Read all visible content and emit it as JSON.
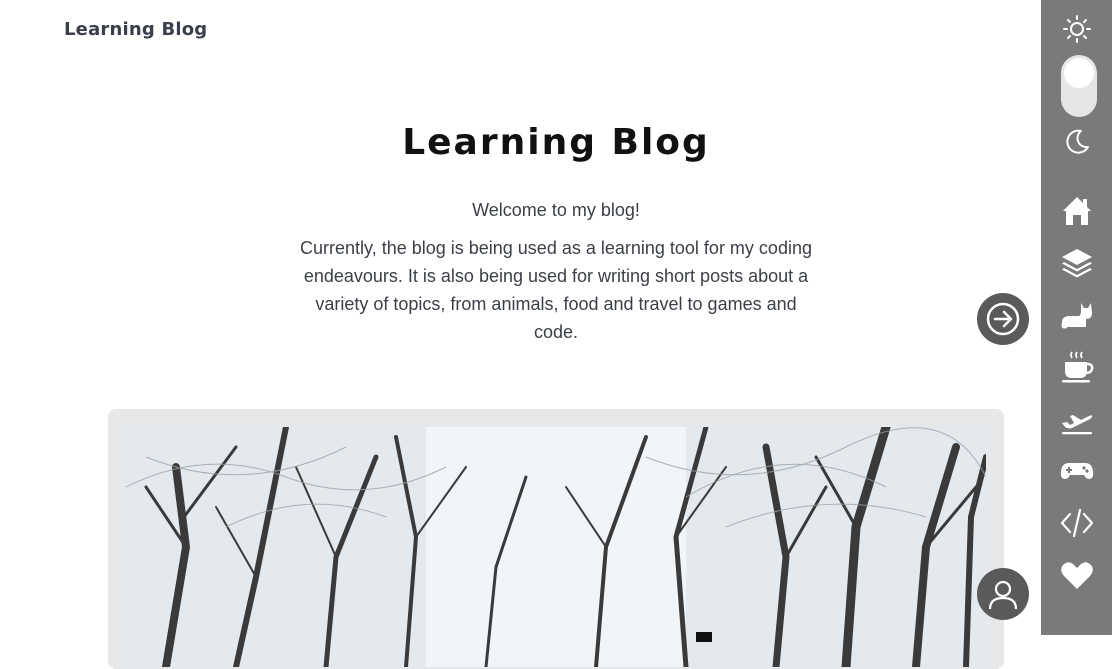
{
  "header": {
    "brand": "Learning Blog"
  },
  "hero": {
    "title": "Learning Blog",
    "welcome": "Welcome to my blog!",
    "intro": "Currently, the blog is being used as a learning tool for my coding endeavours. It is also being used for writing short posts about a variety of topics, from animals, food and travel to games and code."
  },
  "sidebar": {
    "theme_toggle": {
      "light_icon": "sun-icon",
      "dark_icon": "moon-icon",
      "state": "light"
    },
    "items": [
      {
        "id": "home",
        "icon": "house-icon"
      },
      {
        "id": "all-posts",
        "icon": "layers-icon"
      },
      {
        "id": "animals",
        "icon": "cat-icon"
      },
      {
        "id": "food",
        "icon": "coffee-cup-icon"
      },
      {
        "id": "travel",
        "icon": "airplane-icon"
      },
      {
        "id": "games",
        "icon": "gamepad-icon"
      },
      {
        "id": "code",
        "icon": "code-icon"
      },
      {
        "id": "favorites",
        "icon": "heart-icon"
      }
    ]
  },
  "buttons": {
    "next_icon": "arrow-right-circle-icon",
    "profile_icon": "user-icon"
  },
  "colors": {
    "sidebar_bg": "#7a7a7a",
    "button_bg": "#5a5a5a",
    "card_bg": "#e7e8ea"
  }
}
